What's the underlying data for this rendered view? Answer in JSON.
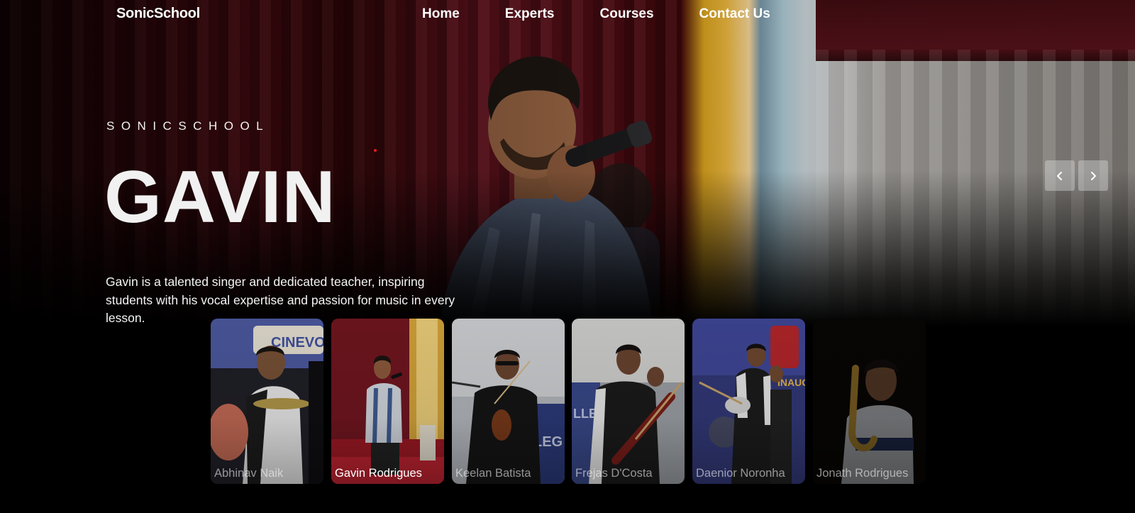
{
  "nav": {
    "logo": "SonicSchool",
    "links": [
      "Home",
      "Experts",
      "Courses",
      "Contact Us"
    ]
  },
  "hero": {
    "eyebrow": "SONICSCHOOL",
    "title": "GAVIN",
    "description": "Gavin is a talented singer and dedicated teacher, inspiring students with his vocal expertise and passion for music in every lesson."
  },
  "controls": {
    "prev_icon": "chevron-left-icon",
    "next_icon": "chevron-right-icon"
  },
  "experts": [
    {
      "name": "Abhinav Naik"
    },
    {
      "name": "Gavin Rodrigues"
    },
    {
      "name": "Keelan Batista"
    },
    {
      "name": "Frejas D'Costa"
    },
    {
      "name": "Daenior Noronha"
    },
    {
      "name": "Jonath Rodrigues"
    }
  ],
  "active_expert_index": 1,
  "colors": {
    "accent_dot": "#e21b1b",
    "background": "#000000",
    "text": "#ffffff"
  }
}
